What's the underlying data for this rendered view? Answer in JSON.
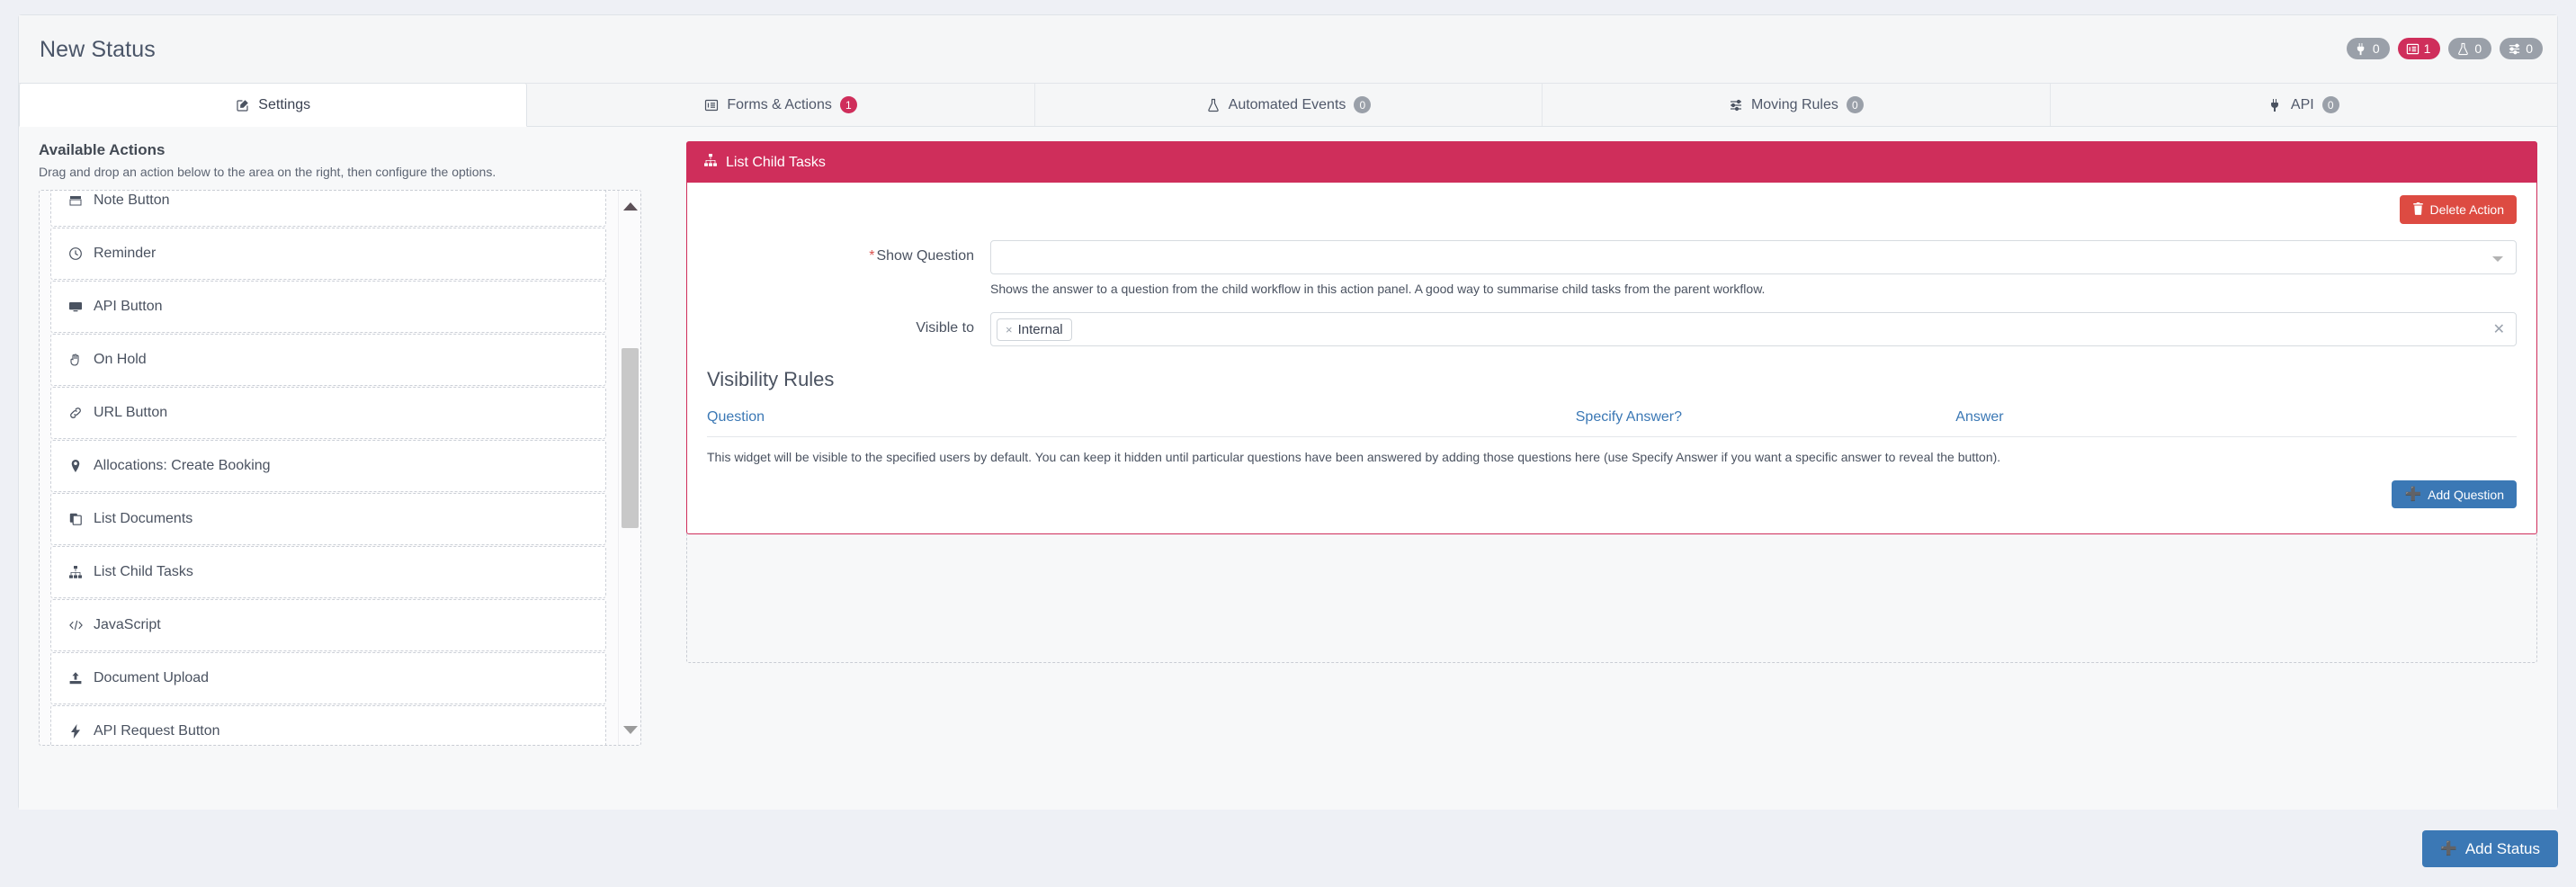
{
  "header": {
    "title": "New Status",
    "badges": [
      {
        "name": "plug-icon",
        "icon": "plug",
        "count": "0",
        "accent": false
      },
      {
        "name": "forms-icon",
        "icon": "forms",
        "count": "1",
        "accent": true
      },
      {
        "name": "flask-icon",
        "icon": "flask",
        "count": "0",
        "accent": false
      },
      {
        "name": "sliders-icon",
        "icon": "sliders",
        "count": "0",
        "accent": false
      }
    ]
  },
  "tabs": [
    {
      "label": "Settings",
      "icon": "edit-square",
      "count": null,
      "active": true,
      "accent": false
    },
    {
      "label": "Forms & Actions",
      "icon": "forms",
      "count": "1",
      "active": false,
      "accent": true
    },
    {
      "label": "Automated Events",
      "icon": "flask",
      "count": "0",
      "active": false,
      "accent": false
    },
    {
      "label": "Moving Rules",
      "icon": "sliders",
      "count": "0",
      "active": false,
      "accent": false
    },
    {
      "label": "API",
      "icon": "plug",
      "count": "0",
      "active": false,
      "accent": false
    }
  ],
  "sidebar": {
    "title": "Available Actions",
    "subtitle": "Drag and drop an action below to the area on the right, then configure the options.",
    "items": [
      {
        "label": "Note Button",
        "icon": "note"
      },
      {
        "label": "Reminder",
        "icon": "clock"
      },
      {
        "label": "API Button",
        "icon": "monitor"
      },
      {
        "label": "On Hold",
        "icon": "hand"
      },
      {
        "label": "URL Button",
        "icon": "link"
      },
      {
        "label": "Allocations: Create Booking",
        "icon": "map-pin"
      },
      {
        "label": "List Documents",
        "icon": "copy"
      },
      {
        "label": "List Child Tasks",
        "icon": "sitemap"
      },
      {
        "label": "JavaScript",
        "icon": "code"
      },
      {
        "label": "Document Upload",
        "icon": "upload"
      },
      {
        "label": "API Request Button",
        "icon": "bolt"
      }
    ]
  },
  "action_panel": {
    "title": "List Child Tasks",
    "title_icon": "sitemap",
    "delete_label": "Delete Action",
    "show_question": {
      "label": "Show Question",
      "required": true,
      "value": "",
      "help": "Shows the answer to a question from the child workflow in this action panel. A good way to summarise child tasks from the parent workflow."
    },
    "visible_to": {
      "label": "Visible to",
      "tokens": [
        "Internal"
      ]
    },
    "visibility_rules": {
      "heading": "Visibility Rules",
      "columns": [
        "Question",
        "Specify Answer?",
        "Answer"
      ],
      "rows": [],
      "note": "This widget will be visible to the specified users by default. You can keep it hidden until particular questions have been answered by adding those questions here (use Specify Answer if you want a specific answer to reveal the button).",
      "add_label": "Add Question"
    }
  },
  "footer": {
    "add_status_label": "Add Status"
  },
  "colors": {
    "accent": "#cf2e5b",
    "primary": "#3b78b5",
    "danger": "#dd4b42",
    "link": "#3b78b5"
  }
}
